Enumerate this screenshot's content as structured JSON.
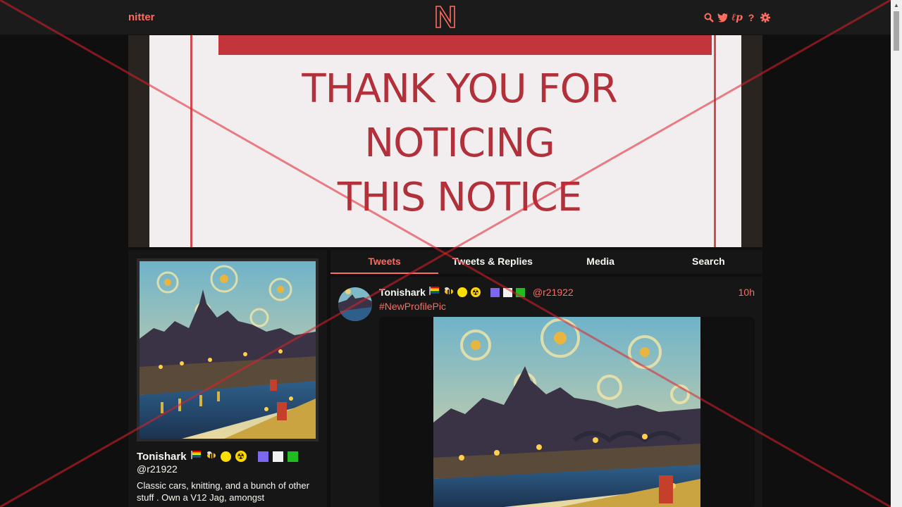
{
  "nav": {
    "brand": "nitter",
    "logo_letter": "N",
    "icons": [
      "search-icon",
      "twitter-bird-icon",
      "lp-icon",
      "question-icon",
      "gear-icon"
    ]
  },
  "banner": {
    "lines": [
      "THANK YOU FOR",
      "NOTICING",
      "THIS NOTICE"
    ]
  },
  "profile": {
    "fullname": "Tonishark",
    "username": "@r21922",
    "bio": "Classic cars, knitting, and a bunch of other stuff .  Own a V12 Jag, amongst",
    "squares": [
      "#7b68ee",
      "#f2f2f2",
      "#22bb22"
    ]
  },
  "tabs": [
    "Tweets",
    "Tweets & Replies",
    "Media",
    "Search"
  ],
  "tweet": {
    "fullname": "Tonishark",
    "username": "@r21922",
    "date": "10h",
    "text": "#NewProfilePic"
  },
  "colors": {
    "accent": "#ff6c60",
    "background": "#0f0f0f",
    "panel": "#161616"
  }
}
